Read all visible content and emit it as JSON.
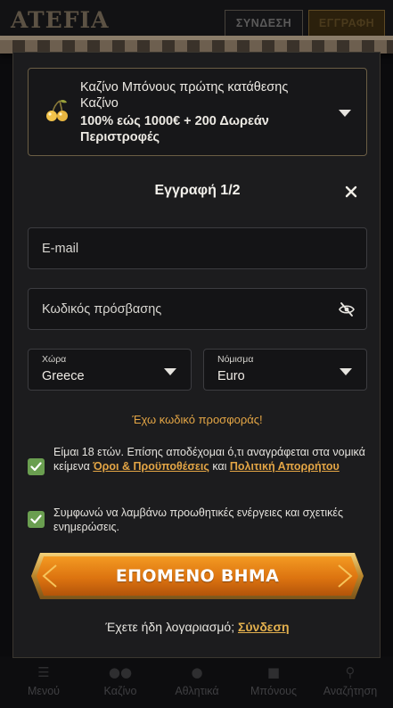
{
  "header": {
    "logo": "ATEFIA",
    "login_label": "ΣΥΝΔΕΣΗ",
    "register_label": "ΕΓΓΡΑΦΗ"
  },
  "bonus": {
    "icon": "cherries-icon",
    "title": "Καζίνο Μπόνους πρώτης κατάθεσης Καζίνο",
    "offer": "100% εώς 1000€ + 200 Δωρεάν Περιστροφές"
  },
  "form": {
    "step_title": "Εγγραφή 1/2",
    "email_placeholder": "E-mail",
    "password_placeholder": "Κωδικός πρόσβασης",
    "country_label": "Χώρα",
    "country_value": "Greece",
    "currency_label": "Νόμισμα",
    "currency_value": "Euro",
    "promo_link": "Έχω κωδικό προσφοράς!",
    "age_text_before": "Είμαι 18 ετών. Επίσης αποδέχομαι ό,τι αναγράφεται στα νομικά κείμενα ",
    "terms_link": "Όροι & Προϋποθέσεις",
    "age_text_middle": " και ",
    "privacy_link": "Πολιτική Απορρήτου",
    "promo_consent_text": "Συμφωνώ να λαμβάνω προωθητικές ενέργειες και σχετικές ενημερώσεις.",
    "age_checked": true,
    "promo_checked": true,
    "next_button": "ΕΠΟΜΕΝΟ ΒΗΜΑ",
    "have_account_text": "Έχετε ήδη λογαριασμό;",
    "login_link": "Σύνδεση"
  },
  "bottom_nav": [
    {
      "label": "Μενού",
      "icon": "menu-icon"
    },
    {
      "label": "Καζίνο",
      "icon": "chips-icon"
    },
    {
      "label": "Αθλητικά",
      "icon": "ball-icon"
    },
    {
      "label": "Μπόνους",
      "icon": "gift-icon"
    },
    {
      "label": "Αναζήτηση",
      "icon": "search-icon"
    }
  ],
  "colors": {
    "accent_gold": "#e3a545",
    "button_orange": "#e07a12",
    "checkbox_green": "#6a9e50",
    "modal_bg": "#1c1c1e"
  }
}
